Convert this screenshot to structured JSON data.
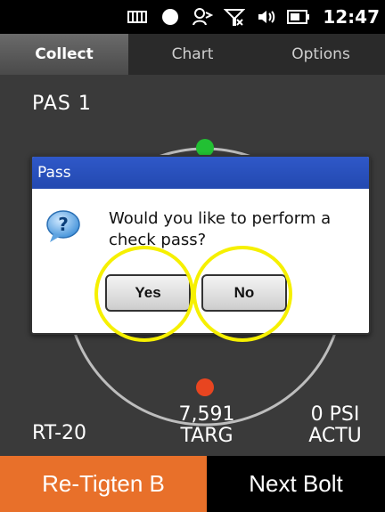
{
  "status_bar": {
    "time": "12:47",
    "icons": [
      "battery-grid-icon",
      "circle-icon",
      "contacts-icon",
      "signal-off-icon",
      "speaker-icon",
      "battery-icon"
    ]
  },
  "tabs": [
    {
      "label": "Collect",
      "active": true
    },
    {
      "label": "Chart",
      "active": false
    },
    {
      "label": "Options",
      "active": false
    }
  ],
  "main": {
    "pass_label": "PAS 1",
    "left_value": "RT-20",
    "mid_value": "7,591",
    "mid_label": "TARG",
    "right_value": "0 PSI",
    "right_label": "ACTU"
  },
  "dialog": {
    "title": "Pass",
    "message": "Would you like to perform a check pass?",
    "yes_label": "Yes",
    "no_label": "No"
  },
  "bottom": {
    "retighten_label": "Re-Tigten B",
    "next_label": "Next Bolt"
  },
  "colors": {
    "accent_orange": "#e8702a",
    "dialog_title_blue": "#2a50c0",
    "highlight_yellow": "#f6f000",
    "gauge_green": "#22c033",
    "gauge_red": "#e84520"
  }
}
